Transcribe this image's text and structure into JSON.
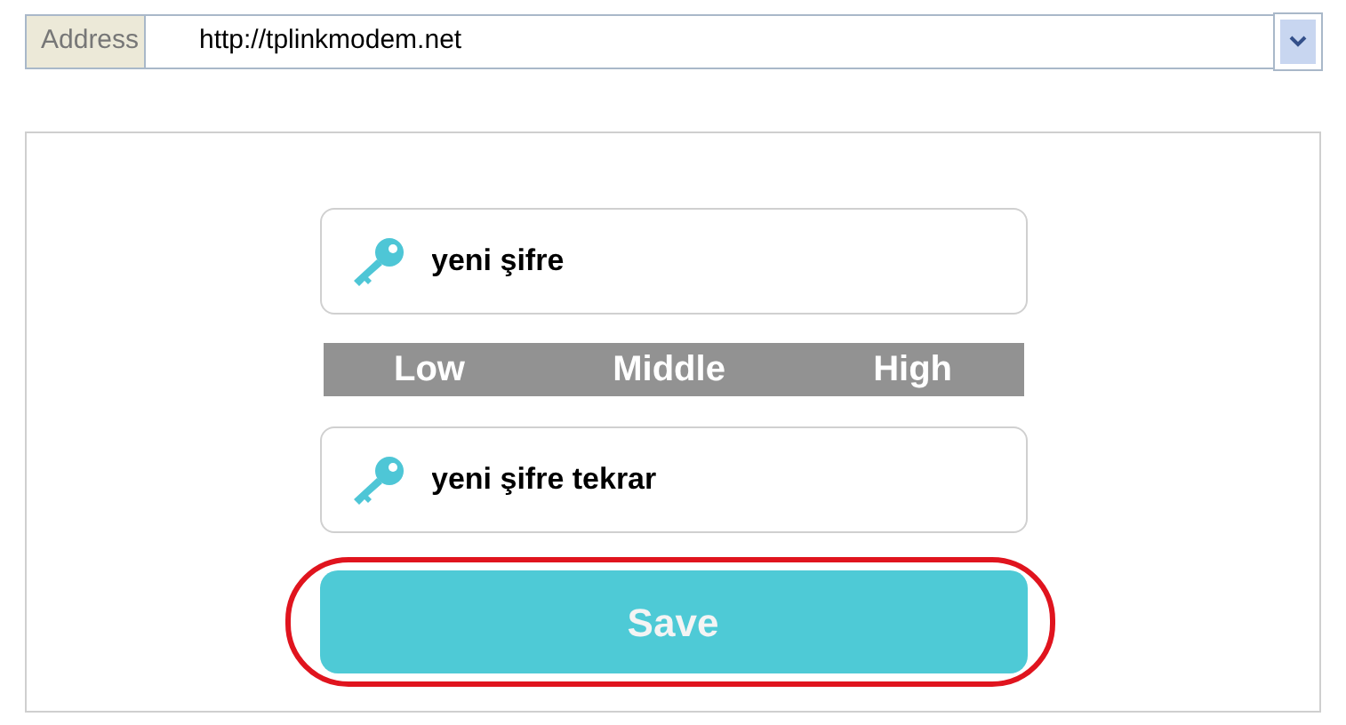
{
  "address_bar": {
    "label": "Address",
    "value": "http://tplinkmodem.net"
  },
  "fields": [
    {
      "value": "yeni şifre"
    },
    {
      "value": "yeni şifre tekrar"
    }
  ],
  "strength": [
    {
      "label": "Low",
      "selected": false
    },
    {
      "label": "Middle",
      "selected": false
    },
    {
      "label": "High",
      "selected": false
    }
  ],
  "save_button": {
    "label": "Save",
    "highlighted": true
  }
}
